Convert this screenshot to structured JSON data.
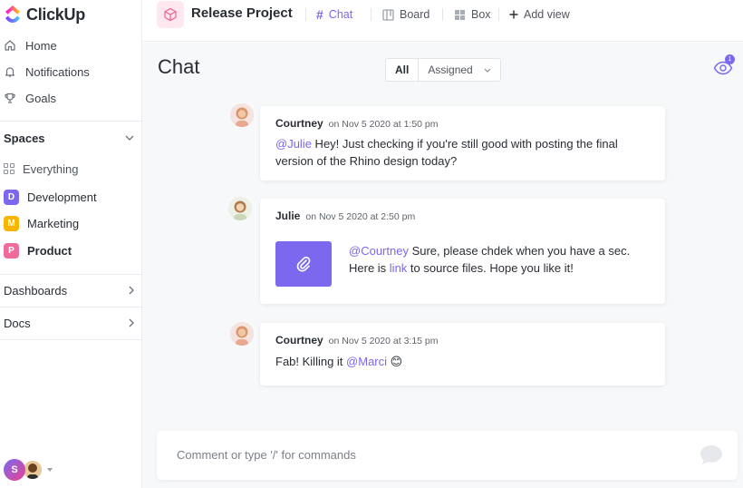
{
  "sidebar": {
    "logo": "ClickUp",
    "nav": [
      {
        "label": "Home",
        "icon": "home-icon"
      },
      {
        "label": "Notifications",
        "icon": "bell-icon"
      },
      {
        "label": "Goals",
        "icon": "trophy-icon"
      }
    ],
    "spaces_label": "Spaces",
    "everything_label": "Everything",
    "spaces": [
      {
        "letter": "D",
        "label": "Development",
        "color": "#7b68ee"
      },
      {
        "letter": "M",
        "label": "Marketing",
        "color": "#f8b500"
      },
      {
        "letter": "P",
        "label": "Product",
        "color": "#f06a9b"
      }
    ],
    "dashboards_label": "Dashboards",
    "docs_label": "Docs",
    "user_initial": "S"
  },
  "topbar": {
    "project_title": "Release Project",
    "views": [
      {
        "label": "Chat",
        "active": true
      },
      {
        "label": "Board",
        "active": false
      },
      {
        "label": "Box",
        "active": false
      }
    ],
    "add_view_label": "Add view"
  },
  "main": {
    "title": "Chat",
    "filter": {
      "all_label": "All",
      "assigned_label": "Assigned"
    },
    "watchers_count": "1",
    "messages": [
      {
        "author": "Courtney",
        "time": "on Nov 5 2020 at 1:50 pm",
        "mention": "@Julie",
        "text": " Hey! Just checking if you're still good with posting the final version of the Rhino design today?"
      },
      {
        "author": "Julie",
        "time": "on Nov 5 2020 at 2:50 pm",
        "mention": "@Courtney",
        "text_a": " Sure, please chdek when you have a sec. Here is ",
        "link": "link",
        "text_b": " to source files. Hope you like it!"
      },
      {
        "author": "Courtney",
        "time": "on Nov 5 2020 at 3:15 pm",
        "text": "Fab! Killing it ",
        "mention": "@Marci",
        "emoji": "😊"
      }
    ],
    "comment_placeholder": "Comment or type '/' for commands"
  },
  "colors": {
    "accent": "#7b68ee",
    "pink": "#f06a9b",
    "yellow": "#f8b500"
  }
}
